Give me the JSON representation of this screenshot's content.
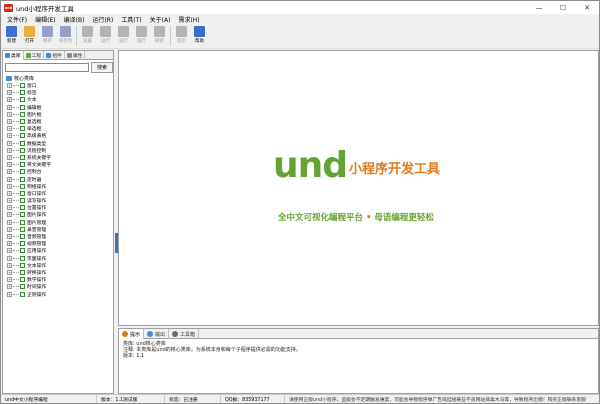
{
  "window": {
    "title": "und小程序开发工具",
    "logo_text": "und",
    "minimize": "—",
    "maximize": "☐",
    "close": "✕"
  },
  "menu": [
    "文件(F)",
    "编辑(E)",
    "编译(B)",
    "运行(R)",
    "工具(T)",
    "关于(A)",
    "需求(H)"
  ],
  "toolbar": [
    {
      "label": "新建",
      "icon": "new-file-icon",
      "color": "#3d6fd1",
      "enabled": true
    },
    {
      "label": "打开",
      "icon": "open-folder-icon",
      "color": "#e2b23a",
      "enabled": true
    },
    {
      "label": "保存",
      "icon": "save-icon",
      "color": "#2b3b8f",
      "enabled": false
    },
    {
      "label": "另存为",
      "icon": "save-as-icon",
      "color": "#2b3b8f",
      "enabled": false
    },
    {
      "label": "设置",
      "icon": "gear-icon",
      "color": "#6a6a6a",
      "enabled": false
    },
    {
      "label": "运行",
      "icon": "run-icon",
      "color": "#6a6a6a",
      "enabled": false
    },
    {
      "label": "运行",
      "icon": "run-all-icon",
      "color": "#6a6a6a",
      "enabled": false
    },
    {
      "label": "运行",
      "icon": "debug-icon",
      "color": "#6a6a6a",
      "enabled": false
    },
    {
      "label": "刷新",
      "icon": "refresh-icon",
      "color": "#6a6a6a",
      "enabled": false
    },
    {
      "label": "首页",
      "icon": "home-icon",
      "color": "#6a6a6a",
      "enabled": false
    },
    {
      "label": "帮助",
      "icon": "help-icon",
      "color": "#3a6fc4",
      "enabled": true
    }
  ],
  "left_tabs": [
    {
      "label": "类库",
      "color": "#3a8fd8",
      "active": true
    },
    {
      "label": "工程",
      "color": "#6a9f3a",
      "active": false
    },
    {
      "label": "组件",
      "color": "#3a8fd8",
      "active": false
    },
    {
      "label": "属性",
      "color": "#8a8a8a",
      "active": false
    }
  ],
  "search": {
    "value": "",
    "button": "搜索"
  },
  "tree": {
    "root": "核心类库",
    "items": [
      "窗口",
      "标签",
      "文本",
      "编辑框",
      "图片框",
      "复选框",
      "单选框",
      "高级表格",
      "数据类型",
      "流程控制",
      "系统关键字",
      "英文关键字",
      "控制台",
      "定时器",
      "网络操作",
      "窗口操作",
      "读写操作",
      "位置操作",
      "图片操作",
      "图片管理",
      "录音管理",
      "音频管理",
      "视频管理",
      "应用操作",
      "页面操作",
      "文本操作",
      "转换操作",
      "数学操作",
      "时间操作",
      "正则操作"
    ]
  },
  "main": {
    "logo_word": "und",
    "logo_name": "小程序开发工具",
    "slogan_left": "全中文可视化编程平台",
    "slogan_dot": "•",
    "slogan_right": "母语编程更轻松"
  },
  "bottom_tabs": [
    {
      "label": "提示",
      "color": "#e07a1d",
      "active": true
    },
    {
      "label": "输出",
      "color": "#3a8fd8",
      "active": false
    },
    {
      "label": "工具箱",
      "color": "#6a6a6a",
      "active": false
    }
  ],
  "bottom_lines": [
    "类库: und核心类库",
    "注释: 本类库是und的核心类库，为系统本身和每个子程序提供必需的功能支持。",
    "版本: 1.1"
  ],
  "status": [
    "und中文小程序编程",
    "版本：1.1测试版",
    "状态：已注册",
    "QQ群：835937177",
    "请使用正版und小程序，盗版会不定期触发难度，可能会导致程序弹广告或挂接某些不良网站病毒木马等，导致程序出错！购买正版联系客服"
  ]
}
